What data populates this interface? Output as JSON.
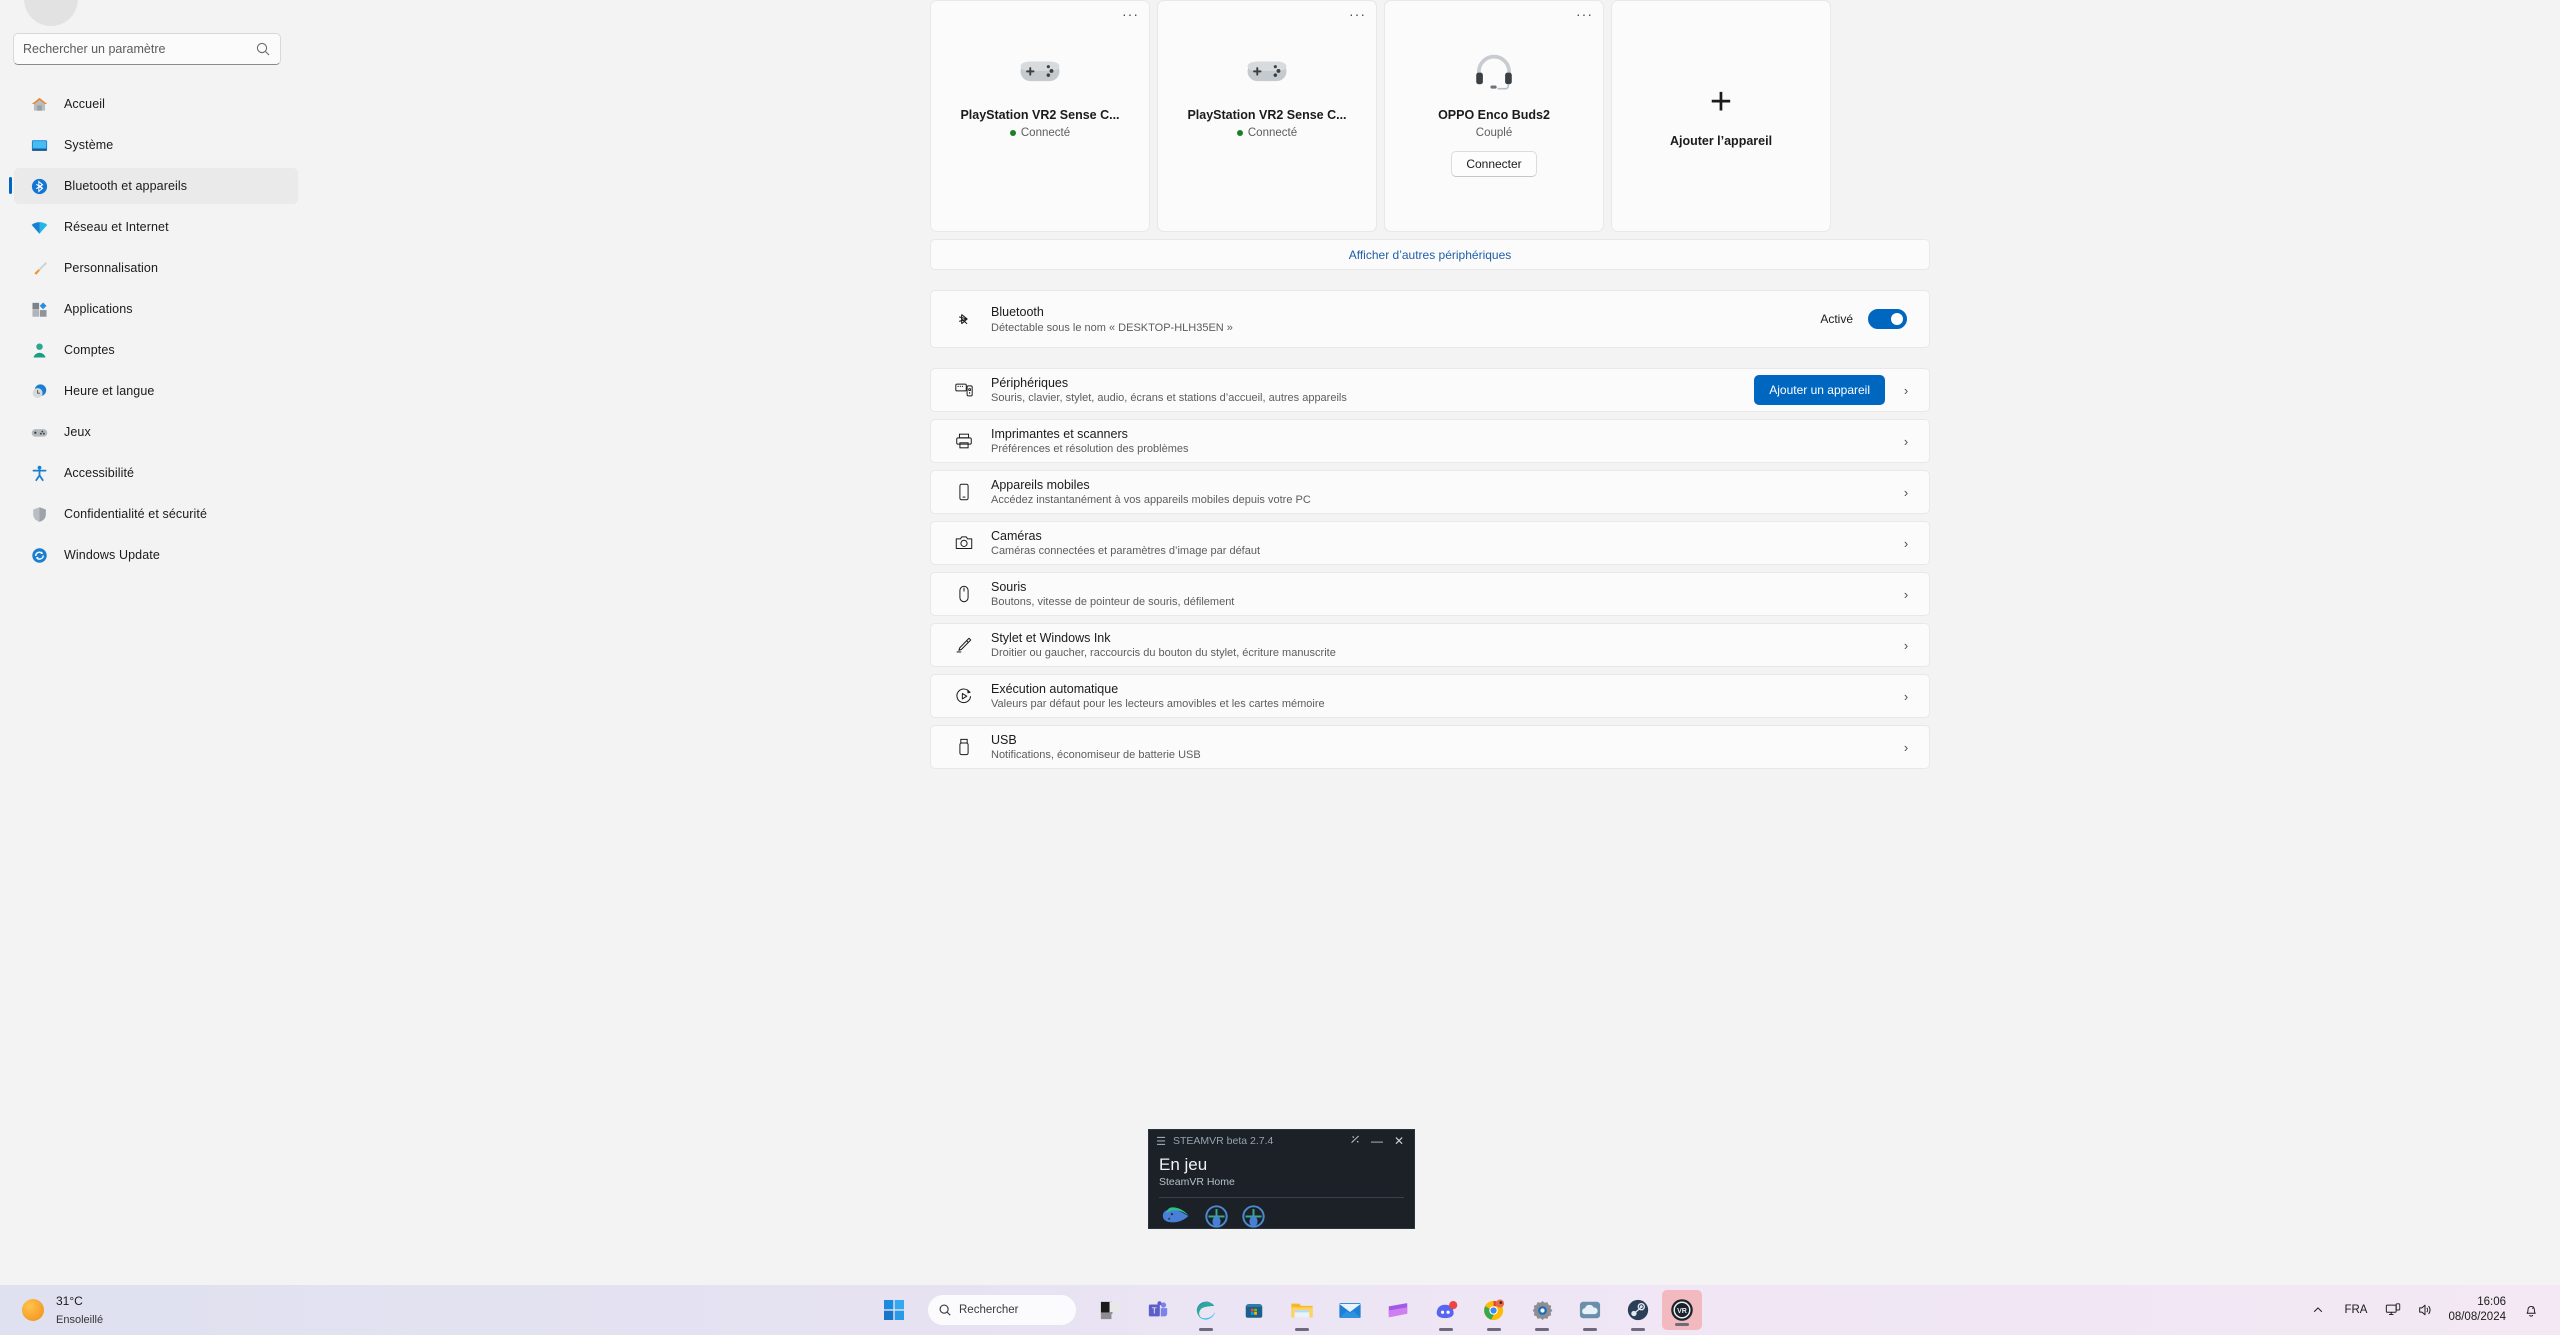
{
  "sidebar": {
    "search": {
      "placeholder": "Rechercher un paramètre",
      "value": "",
      "icon": "search-icon"
    },
    "items": [
      {
        "label": "Accueil",
        "icon": "home-icon"
      },
      {
        "label": "Système",
        "icon": "monitor-icon"
      },
      {
        "label": "Bluetooth et appareils",
        "icon": "bluetooth-icon",
        "active": true
      },
      {
        "label": "Réseau et Internet",
        "icon": "wifi-icon"
      },
      {
        "label": "Personnalisation",
        "icon": "paintbrush-icon"
      },
      {
        "label": "Applications",
        "icon": "apps-icon"
      },
      {
        "label": "Comptes",
        "icon": "person-icon"
      },
      {
        "label": "Heure et langue",
        "icon": "clock-globe-icon"
      },
      {
        "label": "Jeux",
        "icon": "gamepad-icon"
      },
      {
        "label": "Accessibilité",
        "icon": "accessibility-icon"
      },
      {
        "label": "Confidentialité et sécurité",
        "icon": "shield-icon"
      },
      {
        "label": "Windows Update",
        "icon": "update-icon"
      }
    ]
  },
  "devices": {
    "cards": [
      {
        "name": "PlayStation VR2 Sense C...",
        "status": "Connecté",
        "connected": true,
        "icon": "gamepad-device-icon",
        "menu": "···"
      },
      {
        "name": "PlayStation VR2 Sense C...",
        "status": "Connecté",
        "connected": true,
        "icon": "gamepad-device-icon",
        "menu": "···"
      },
      {
        "name": "OPPO Enco Buds2",
        "status": "Couplé",
        "connected": false,
        "icon": "headset-device-icon",
        "menu": "···",
        "action": "Connecter"
      }
    ],
    "add_card": {
      "label": "Ajouter l’appareil",
      "icon": "plus-icon",
      "plus": "+"
    },
    "show_more": "Afficher d’autres périphériques"
  },
  "bluetooth": {
    "title": "Bluetooth",
    "subtitle": "Détectable sous le nom « DESKTOP-HLH35EN »",
    "state_label": "Activé",
    "enabled": true,
    "icon": "bluetooth-icon"
  },
  "settings_rows": [
    {
      "title": "Périphériques",
      "subtitle": "Souris, clavier, stylet, audio, écrans et stations d’accueil, autres appareils",
      "icon": "devices-icon",
      "button": "Ajouter un appareil"
    },
    {
      "title": "Imprimantes et scanners",
      "subtitle": "Préférences et résolution des problèmes",
      "icon": "printer-icon"
    },
    {
      "title": "Appareils mobiles",
      "subtitle": "Accédez instantanément à vos appareils mobiles depuis votre PC",
      "icon": "phone-icon"
    },
    {
      "title": "Caméras",
      "subtitle": "Caméras connectées et paramètres d’image par défaut",
      "icon": "camera-icon"
    },
    {
      "title": "Souris",
      "subtitle": "Boutons, vitesse de pointeur de souris, défilement",
      "icon": "mouse-icon"
    },
    {
      "title": "Stylet et Windows Ink",
      "subtitle": "Droitier ou gaucher, raccourcis du bouton du stylet, écriture manuscrite",
      "icon": "pen-icon"
    },
    {
      "title": "Exécution automatique",
      "subtitle": "Valeurs par défaut pour les lecteurs amovibles et les cartes mémoire",
      "icon": "autoplay-icon"
    },
    {
      "title": "USB",
      "subtitle": "Notifications, économiseur de batterie USB",
      "icon": "usb-icon"
    }
  ],
  "steamvr": {
    "window_title": "STEAMVR beta 2.7.4",
    "status": "En jeu",
    "game": "SteamVR Home",
    "menu_icon": "hamburger-icon",
    "settings_icon": "vr-settings-icon",
    "minimize": "—",
    "close": "✕",
    "devices": [
      "headset-icon",
      "controller-left-icon",
      "controller-right-icon"
    ]
  },
  "taskbar": {
    "weather": {
      "temperature": "31°C",
      "condition": "Ensoleillé",
      "icon": "sun-icon"
    },
    "start_icon": "windows-start-icon",
    "search": {
      "label": "Rechercher",
      "icon": "search-icon"
    },
    "apps": [
      {
        "name": "task-view-icon",
        "running": false
      },
      {
        "name": "teams-icon",
        "running": false
      },
      {
        "name": "edge-icon",
        "running": true
      },
      {
        "name": "microsoft-store-icon",
        "running": false
      },
      {
        "name": "file-explorer-icon",
        "running": true
      },
      {
        "name": "mail-icon",
        "running": false
      },
      {
        "name": "clipchamp-icon",
        "running": false
      },
      {
        "name": "discord-icon",
        "running": true
      },
      {
        "name": "chrome-icon",
        "running": true
      },
      {
        "name": "settings-icon",
        "running": true
      },
      {
        "name": "onedrive-icon",
        "running": true
      },
      {
        "name": "steam-icon",
        "running": true
      },
      {
        "name": "steamvr-icon",
        "running": true
      }
    ],
    "tray": {
      "overflow_icon": "chevron-up-icon",
      "language": "FRA",
      "network_icon": "network-icon",
      "volume_icon": "volume-icon",
      "time": "16:06",
      "date": "08/08/2024",
      "notifications_icon": "bell-dnd-icon"
    }
  },
  "colors": {
    "accent": "#0067c0",
    "link": "#1f5fa8",
    "connected": "#1a8022",
    "page_bg": "#f3f3f3",
    "card_bg": "#fbfbfb",
    "vr_bg": "#1b2127"
  }
}
